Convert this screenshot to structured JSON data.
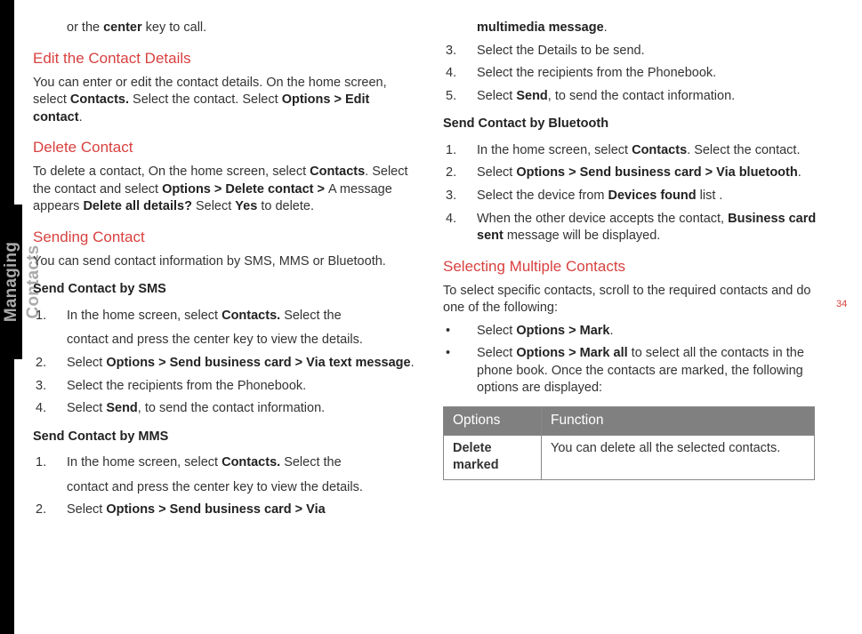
{
  "sidebar": {
    "label": "Managing Contacts"
  },
  "page_number": "34",
  "left": {
    "line1_pre": "or the ",
    "line1_b": "center",
    "line1_post": " key to call.",
    "h_edit": "Edit the Contact Details",
    "p_edit_1": "You can enter or edit the contact details. On the home screen, select ",
    "p_edit_b1": "Contacts.",
    "p_edit_2": " Select the contact. Select ",
    "p_edit_b2": "Options > Edit contact",
    "p_edit_3": ".",
    "h_delete": "Delete Contact",
    "p_del_1": "To delete a contact, On the home screen, select ",
    "p_del_b1": "Contacts",
    "p_del_2": ". Select the contact and select ",
    "p_del_b2": "Options > Delete contact > ",
    "p_del_3": "A message appears ",
    "p_del_b3": "Delete all details?",
    "p_del_4": " Select ",
    "p_del_b4": "Yes",
    "p_del_5": " to delete.",
    "h_sending": "Sending Contact",
    "p_send": "You can send contact information by SMS, MMS or Bluetooth.",
    "h_sms": "Send Contact by SMS",
    "sms1_a": "In the home screen, select ",
    "sms1_b": "Contacts.",
    "sms1_c": " Select the",
    "sms1_d": "contact and press the center key to view the details.",
    "sms2_a": "Select ",
    "sms2_b": "Options > Send business card > Via text message",
    "sms2_c": ".",
    "sms3": "Select the recipients from the Phonebook.",
    "sms4_a": "Select ",
    "sms4_b": "Send",
    "sms4_c": ", to send the contact information.",
    "h_mms": "Send Contact by MMS",
    "mms1_a": "In the home screen, select ",
    "mms1_b": "Contacts.",
    "mms1_c": " Select the",
    "mms1_d": "contact and press the center key to view the details.",
    "mms2_a": "Select ",
    "mms2_b": "Options > Send business card > Via"
  },
  "right": {
    "cont_b": "multimedia message",
    "cont_c": ".",
    "mms3": "Select the Details to be send.",
    "mms4": "Select the recipients from the Phonebook.",
    "mms5_a": "Select ",
    "mms5_b": "Send",
    "mms5_c": ", to send the contact information.",
    "h_bt": "Send Contact by Bluetooth",
    "bt1_a": "In the home screen, select ",
    "bt1_b": "Contacts",
    "bt1_c": ". Select the contact.",
    "bt2_a": "Select ",
    "bt2_b": "Options > Send business card > Via bluetooth",
    "bt2_c": ".",
    "bt3_a": "Select the device from ",
    "bt3_b": "Devices found",
    "bt3_c": " list .",
    "bt4_a": "When the other device accepts the contact, ",
    "bt4_b": "Business card sent",
    "bt4_c": " message will be displayed.",
    "h_sel": "Selecting Multiple Contacts",
    "p_sel": "To select specific contacts, scroll to the required contacts and do one of the following:",
    "sel_b1_a": "Select ",
    "sel_b1_b": "Options > Mark",
    "sel_b1_c": ".",
    "sel_b2_a": "Select ",
    "sel_b2_b": "Options > Mark all",
    "sel_b2_c": " to select all the contacts in the phone book. Once the contacts are marked, the following options are displayed:",
    "table": {
      "h1": "Options",
      "h2": "Function",
      "r1c1": "Delete marked",
      "r1c2": "You can delete all the selected contacts."
    }
  }
}
